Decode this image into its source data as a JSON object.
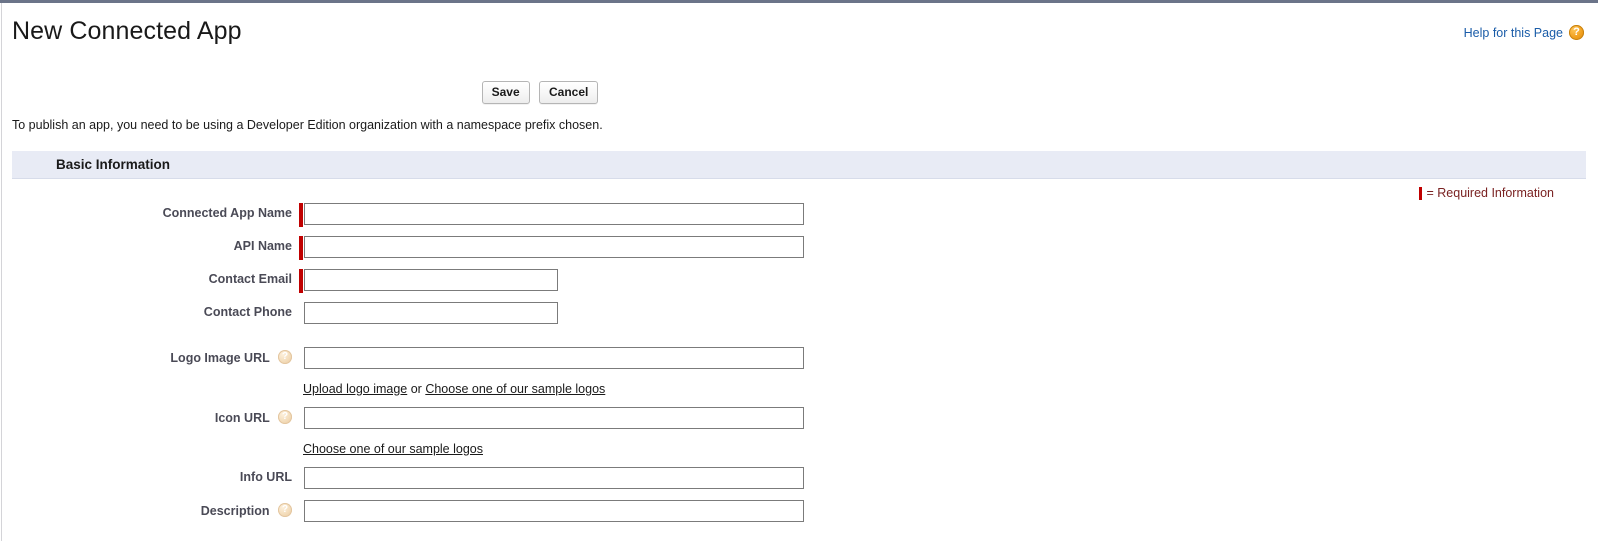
{
  "window": {
    "top_border_color": "#6b7489"
  },
  "header": {
    "title": "New Connected App",
    "help_link": "Help for this Page",
    "help_icon": "question-mark-circle-icon"
  },
  "toolbar": {
    "save_label": "Save",
    "cancel_label": "Cancel"
  },
  "notice": {
    "publish_note": "To publish an app, you need to be using a Developer Edition organization with a namespace prefix chosen."
  },
  "section": {
    "title": "Basic Information",
    "required_legend": "= Required Information",
    "required_color": "#c00000",
    "header_bg": "#e8ebf5"
  },
  "fields": [
    {
      "name": "connected-app-name",
      "label": "Connected App Name",
      "required": true,
      "has_help": false,
      "value": "",
      "placeholder": "",
      "width": "wide"
    },
    {
      "name": "api-name",
      "label": "API Name",
      "required": true,
      "has_help": false,
      "value": "",
      "placeholder": "",
      "width": "wide"
    },
    {
      "name": "contact-email",
      "label": "Contact Email",
      "required": true,
      "has_help": false,
      "value": "",
      "placeholder": "",
      "width": "short"
    },
    {
      "name": "contact-phone",
      "label": "Contact Phone",
      "required": false,
      "has_help": false,
      "value": "",
      "placeholder": "",
      "width": "short"
    },
    {
      "name": "logo-image-url",
      "label": "Logo Image URL",
      "required": false,
      "has_help": true,
      "value": "",
      "placeholder": "",
      "width": "wide"
    },
    {
      "name": "icon-url",
      "label": "Icon URL",
      "required": false,
      "has_help": true,
      "value": "",
      "placeholder": "",
      "width": "wide"
    },
    {
      "name": "info-url",
      "label": "Info URL",
      "required": false,
      "has_help": false,
      "value": "",
      "placeholder": "",
      "width": "wide"
    },
    {
      "name": "description",
      "label": "Description",
      "required": false,
      "has_help": true,
      "value": "",
      "placeholder": "",
      "width": "wide"
    }
  ],
  "logo_links": {
    "upload": "Upload logo image",
    "conjunction": " or ",
    "sample": "Choose one of our sample logos"
  },
  "icon_links": {
    "sample": "Choose one of our sample logos"
  }
}
